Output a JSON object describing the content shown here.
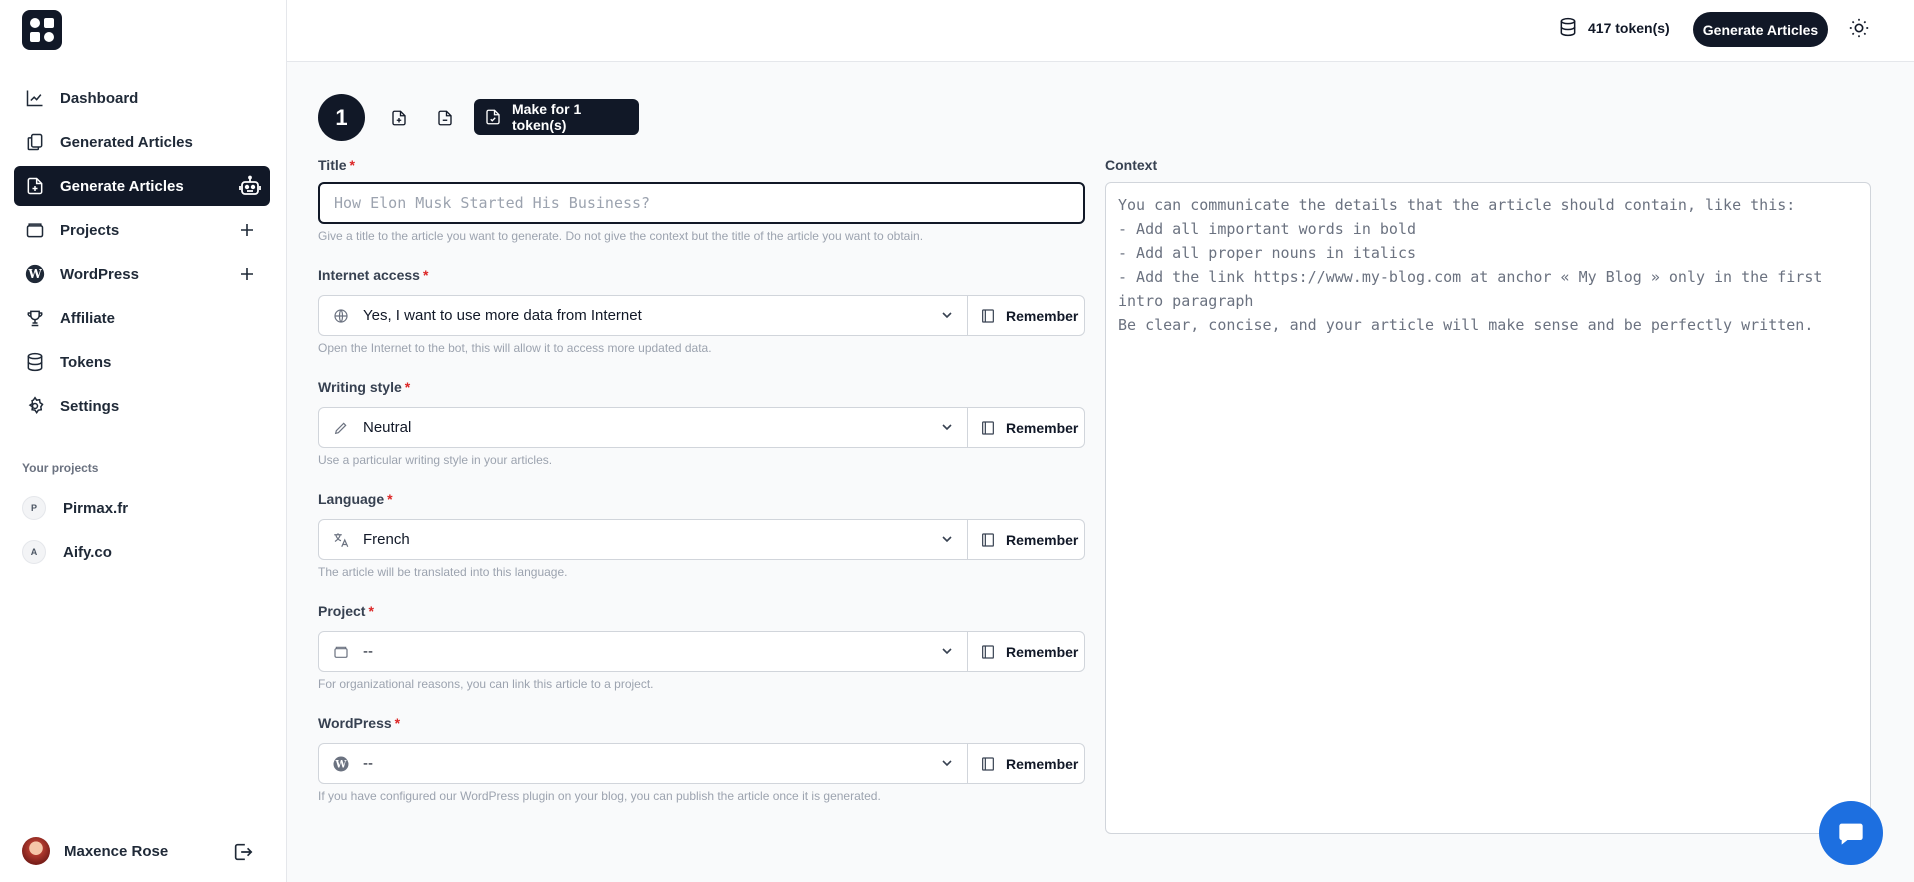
{
  "sidebar": {
    "items": [
      {
        "label": "Dashboard",
        "icon": "chart-icon"
      },
      {
        "label": "Generated Articles",
        "icon": "documents-icon"
      },
      {
        "label": "Generate Articles",
        "icon": "file-plus-icon",
        "active": true
      },
      {
        "label": "Projects",
        "icon": "folder-icon"
      },
      {
        "label": "WordPress",
        "icon": "wordpress-icon"
      },
      {
        "label": "Affiliate",
        "icon": "trophy-icon"
      },
      {
        "label": "Tokens",
        "icon": "database-icon"
      },
      {
        "label": "Settings",
        "icon": "gear-icon"
      }
    ],
    "projects_title": "Your projects",
    "projects": [
      {
        "initial": "P",
        "label": "Pirmax.fr"
      },
      {
        "initial": "A",
        "label": "Aify.co"
      }
    ],
    "user_name": "Maxence Rose"
  },
  "topbar": {
    "tokens": "417 token(s)",
    "generate_label": "Generate Articles"
  },
  "toolbar": {
    "step": "1",
    "make_label": "Make for 1 token(s)"
  },
  "form": {
    "title": {
      "label": "Title",
      "required": "*",
      "placeholder": "How Elon Musk Started His Business?",
      "hint": "Give a title to the article you want to generate. Do not give the context but the title of the article you want to obtain."
    },
    "internet": {
      "label": "Internet access",
      "required": "*",
      "value": "Yes, I want to use more data from Internet",
      "hint": "Open the Internet to the bot, this will allow it to access more updated data."
    },
    "style": {
      "label": "Writing style",
      "required": "*",
      "value": "Neutral",
      "hint": "Use a particular writing style in your articles."
    },
    "language": {
      "label": "Language",
      "required": "*",
      "value": "French",
      "hint": "The article will be translated into this language."
    },
    "project": {
      "label": "Project",
      "required": "*",
      "value": "--",
      "hint": "For organizational reasons, you can link this article to a project."
    },
    "wordpress": {
      "label": "WordPress",
      "required": "*",
      "value": "--",
      "hint": "If you have configured our WordPress plugin on your blog, you can publish the article once it is generated."
    },
    "remember_label": "Remember"
  },
  "context": {
    "label": "Context",
    "placeholder": "You can communicate the details that the article should contain, like this:\n- Add all important words in bold\n- Add all proper nouns in italics\n- Add the link https://www.my-blog.com at anchor « My Blog » only in the first intro paragraph\nBe clear, concise, and your article will make sense and be perfectly written."
  },
  "colors": {
    "accent": "#111827",
    "chat": "#1d6fe0",
    "required": "#dc2626"
  }
}
